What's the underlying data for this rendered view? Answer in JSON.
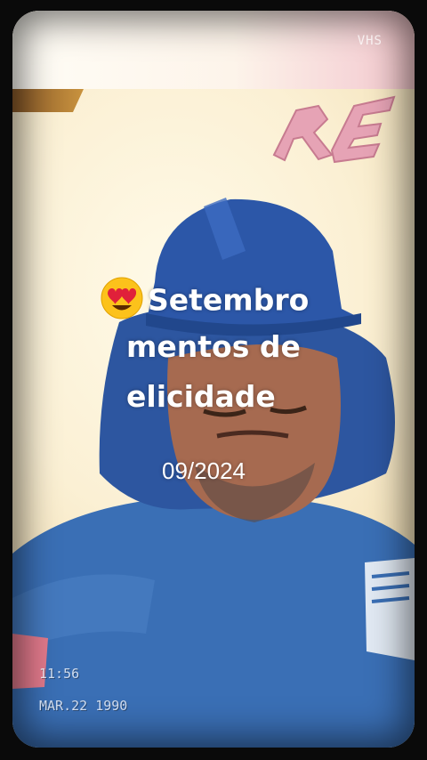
{
  "overlay": {
    "vhs_label": "VHS",
    "time": "11:56",
    "date": "MAR.22 1990"
  },
  "caption": {
    "emoji": "heart-eyes-emoji",
    "line1": "Setembro",
    "line2": "mentos de",
    "line3": "elicidade",
    "date": "09/2024"
  },
  "colors": {
    "shirt": "#3a6fb5",
    "helmet": "#2c57a8",
    "wall": "#fbeed2",
    "sign": "#e6a3b5"
  }
}
